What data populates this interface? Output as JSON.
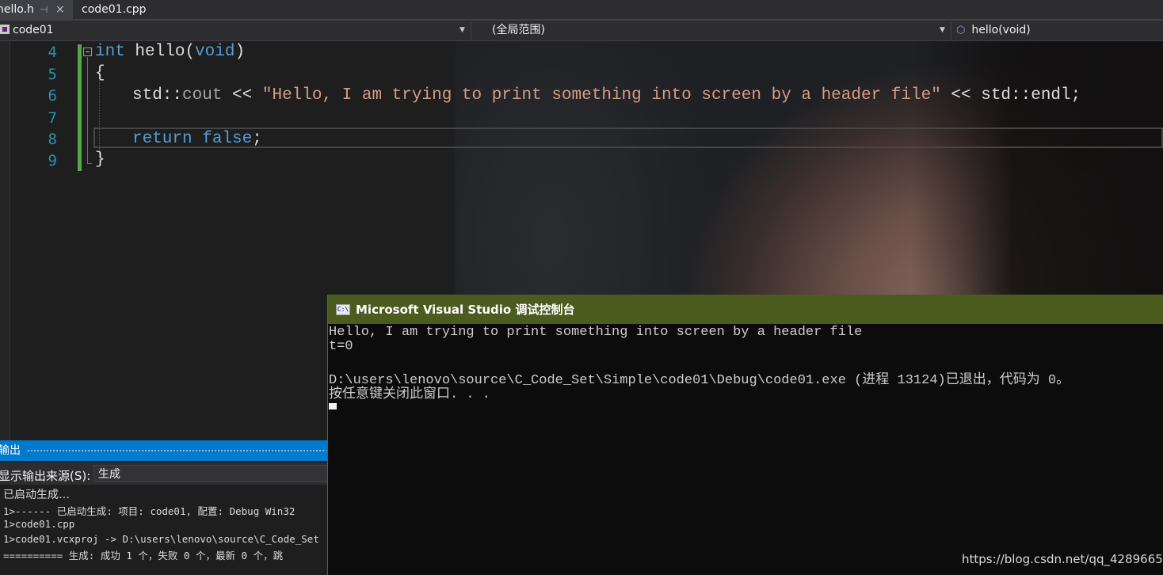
{
  "tabs": [
    {
      "label": "hello.h",
      "pin": "⊣",
      "close": "×"
    },
    {
      "label": "code01.cpp"
    }
  ],
  "navbar": {
    "project": "code01",
    "scope": "(全局范围)",
    "member": "hello(void)"
  },
  "editor": {
    "line_numbers": [
      "4",
      "5",
      "6",
      "7",
      "8",
      "9"
    ],
    "line4": {
      "kw": "int",
      "name": " hello",
      "paren_open": "(",
      "param": "void",
      "paren_close": ")"
    },
    "line5": "{",
    "line6": {
      "prefix": "std::",
      "cout": "cout",
      "op": " << ",
      "string": "\"Hello, I am trying to print something into screen by a header file\"",
      "suffix": " << std::endl;"
    },
    "line8": {
      "kw": "return",
      "value": "false",
      "semi": ";"
    },
    "line9": "}"
  },
  "output": {
    "title": "输出",
    "source_label": "显示输出来源(S):",
    "source_value": "生成",
    "lines": [
      "已启动生成…",
      "1>------ 已启动生成: 项目: code01, 配置: Debug Win32",
      "1>code01.cpp",
      "1>code01.vcxproj -> D:\\users\\lenovo\\source\\C_Code_Set",
      "========== 生成: 成功 1 个，失败 0 个，最新 0 个，跳"
    ]
  },
  "console": {
    "icon_text": "C:\\",
    "title": "Microsoft Visual Studio 调试控制台",
    "lines": [
      "Hello, I am trying to print something into screen by a header file",
      "t=0",
      "",
      "D:\\users\\lenovo\\source\\C_Code_Set\\Simple\\code01\\Debug\\code01.exe (进程 13124)已退出，代码为 0。",
      "按任意键关闭此窗口. . ."
    ]
  },
  "watermark": "https://blog.csdn.net/qq_42896653",
  "colors": {
    "keyword": "#569cd6",
    "string": "#d69d85",
    "line_number": "#2b91af",
    "accent_blue": "#007acc",
    "console_title": "#4c5c1f"
  }
}
